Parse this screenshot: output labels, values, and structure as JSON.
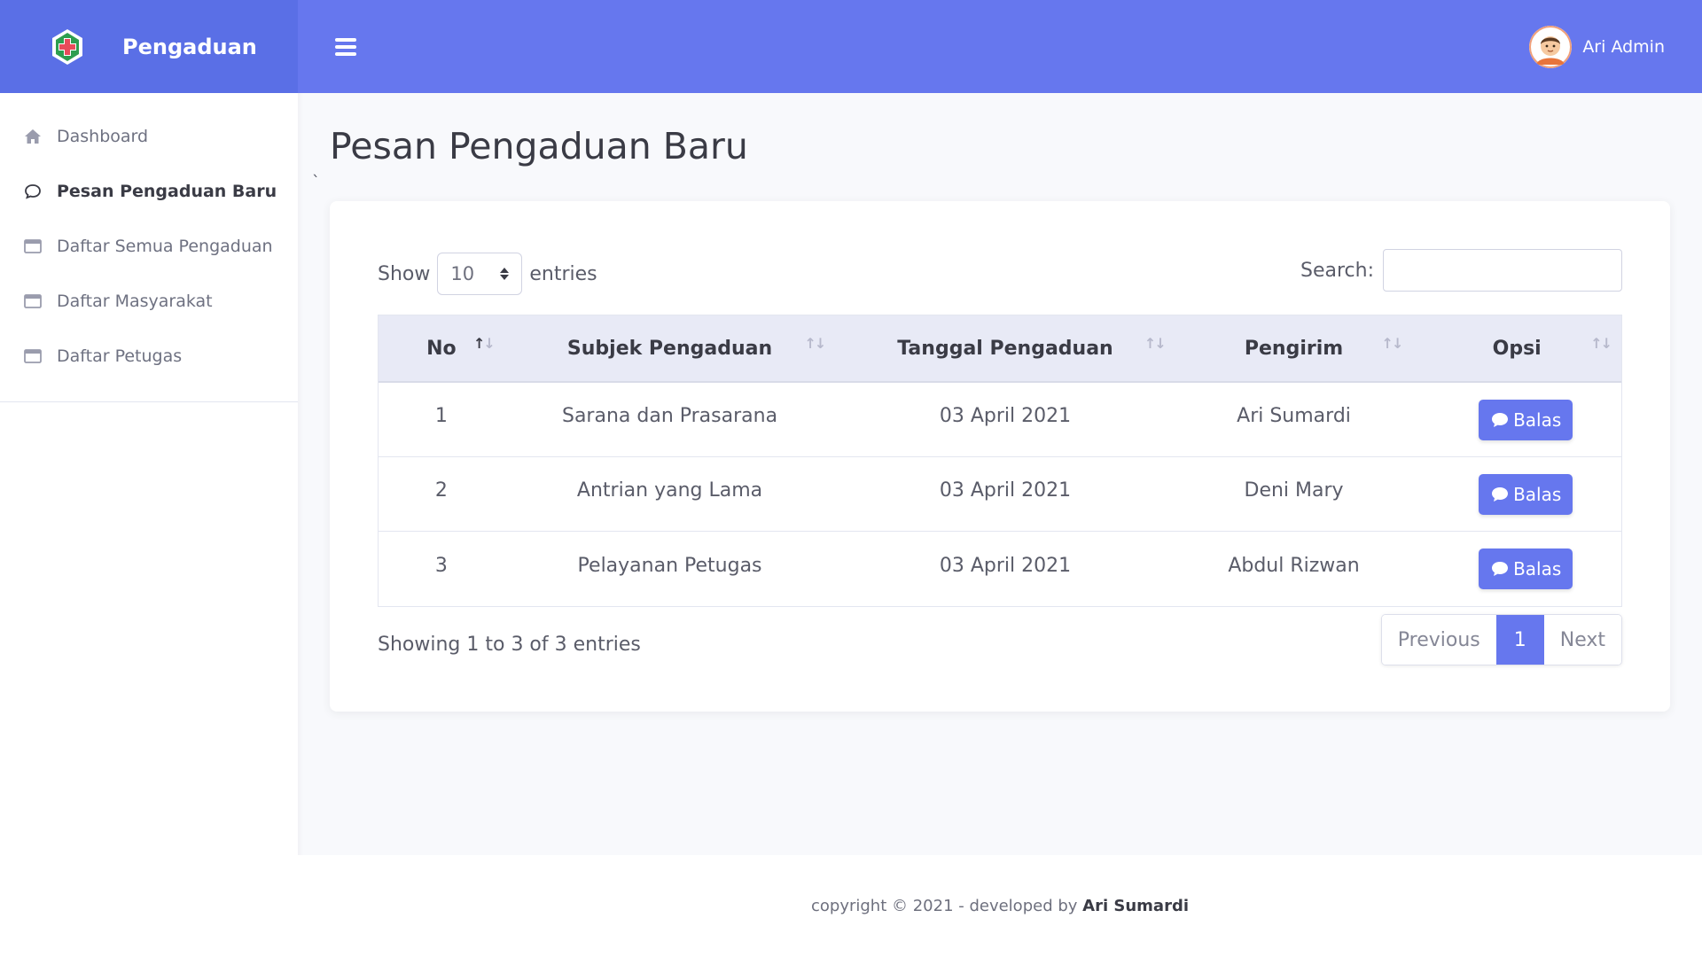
{
  "brand": {
    "name": "Pengaduan",
    "logo_icon": "medical-cross-icon"
  },
  "sidebar": {
    "items": [
      {
        "label": "Dashboard",
        "icon": "home-icon",
        "active": false
      },
      {
        "label": "Pesan Pengaduan Baru",
        "icon": "comment-icon",
        "active": true
      },
      {
        "label": "Daftar Semua Pengaduan",
        "icon": "window-icon",
        "active": false
      },
      {
        "label": "Daftar Masyarakat",
        "icon": "window-icon",
        "active": false
      },
      {
        "label": "Daftar Petugas",
        "icon": "window-icon",
        "active": false
      }
    ]
  },
  "topbar": {
    "user_name": "Ari Admin",
    "menu_icon": "hamburger-icon"
  },
  "page": {
    "title": "Pesan Pengaduan Baru",
    "tick": "`"
  },
  "table_controls": {
    "show_label": "Show",
    "entries_label": "entries",
    "page_length": "10",
    "search_label": "Search:",
    "search_value": ""
  },
  "table": {
    "columns": [
      "No",
      "Subjek Pengaduan",
      "Tanggal Pengaduan",
      "Pengirim",
      "Opsi"
    ],
    "rows": [
      {
        "no": "1",
        "subjek": "Sarana dan Prasarana",
        "tanggal": "03 April 2021",
        "pengirim": "Ari Sumardi",
        "action": "Balas"
      },
      {
        "no": "2",
        "subjek": "Antrian yang Lama",
        "tanggal": "03 April 2021",
        "pengirim": "Deni Mary",
        "action": "Balas"
      },
      {
        "no": "3",
        "subjek": "Pelayanan Petugas",
        "tanggal": "03 April 2021",
        "pengirim": "Abdul Rizwan",
        "action": "Balas"
      }
    ]
  },
  "pagination": {
    "info": "Showing 1 to 3 of 3 entries",
    "previous": "Previous",
    "current": "1",
    "next": "Next"
  },
  "footer": {
    "text": "copyright © 2021 - developed by",
    "author": "Ari Sumardi"
  },
  "colors": {
    "primary": "#6677ee",
    "brand_bg": "#5a6fe6"
  }
}
